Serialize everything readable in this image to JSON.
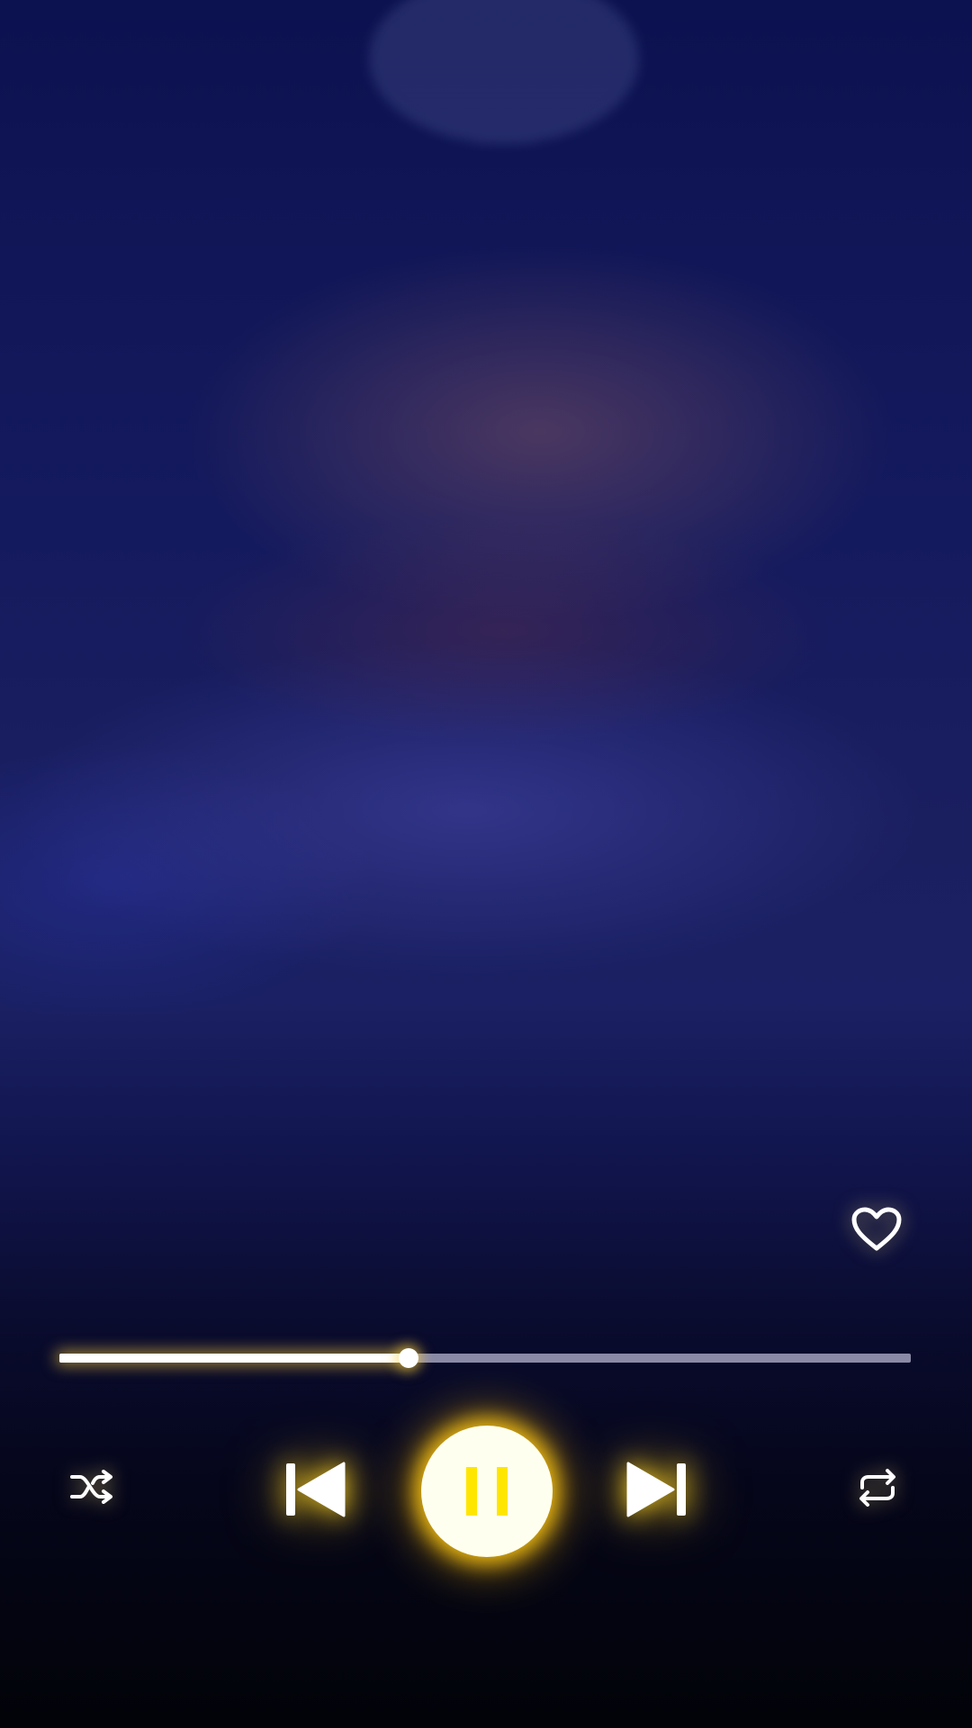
{
  "player": {
    "state": "playing",
    "progress_fraction": 0.41,
    "favorited": false,
    "accent_color": "#FFD400",
    "track_color": "#8A8AA6",
    "fill_color": "#FFFFFF"
  },
  "controls": {
    "favorite_icon": "heart-outline-icon",
    "shuffle_icon": "shuffle-icon",
    "previous_icon": "skip-previous-icon",
    "play_pause_icon": "pause-icon",
    "next_icon": "skip-next-icon",
    "repeat_icon": "repeat-icon"
  }
}
